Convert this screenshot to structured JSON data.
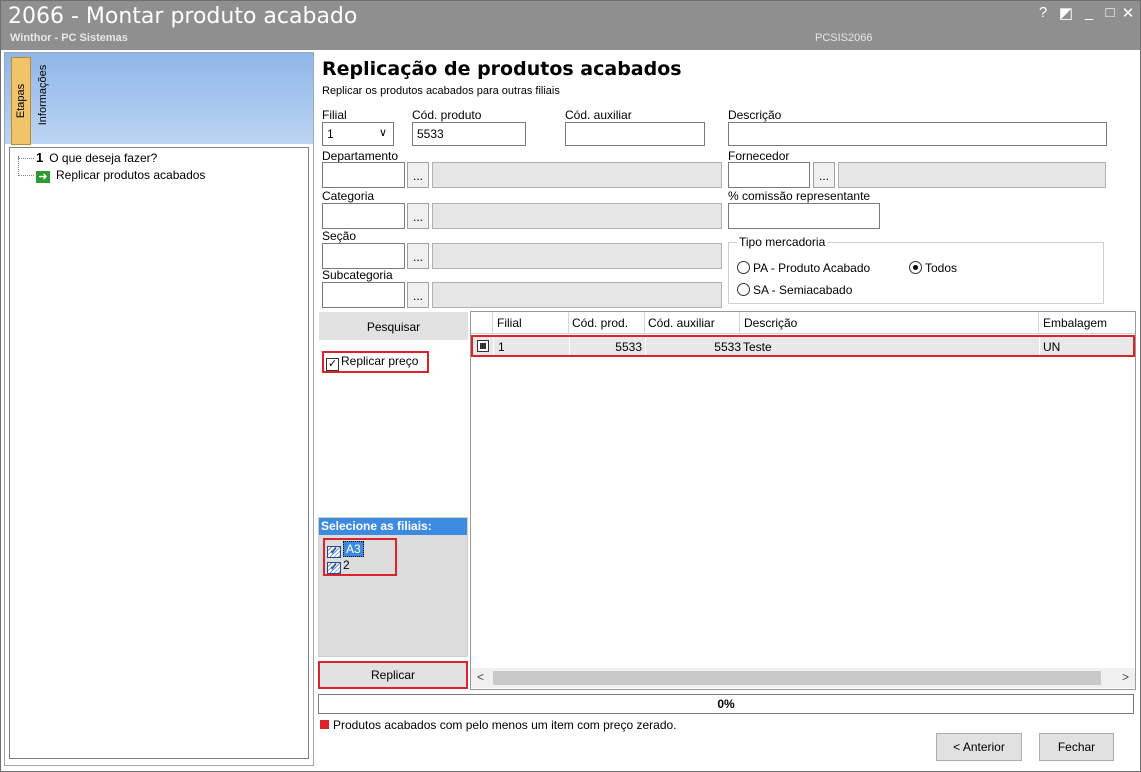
{
  "window": {
    "title": "2066 - Montar produto acabado",
    "subtitle": "Winthor - PC Sistemas",
    "routine_code": "PCSIS2066",
    "help_label": "?",
    "minimize_label": "_",
    "maximize_label": "□",
    "close_label": "✕",
    "restore_label": "◩"
  },
  "left_panel": {
    "tabs": [
      "Etapas",
      "Informações"
    ],
    "steps": [
      {
        "number": "1",
        "label": "O que deseja fazer?"
      },
      {
        "number": "",
        "label": "Replicar produtos acabados"
      }
    ]
  },
  "header": {
    "title": "Replicação de produtos acabados",
    "subtitle": "Replicar os produtos acabados para outras filiais"
  },
  "form": {
    "filial_label": "Filial",
    "filial_value": "1",
    "cod_produto_label": "Cód. produto",
    "cod_produto_value": "5533",
    "cod_auxiliar_label": "Cód. auxiliar",
    "cod_auxiliar_value": "",
    "descricao_label": "Descrição",
    "descricao_value": "",
    "departamento_label": "Departamento",
    "fornecedor_label": "Fornecedor",
    "categoria_label": "Categoria",
    "comissao_label": "% comissão representante",
    "secao_label": "Seção",
    "subcategoria_label": "Subcategoria",
    "lookup_button": "...",
    "tipo_mercadoria": {
      "legend": "Tipo mercadoria",
      "options": [
        "PA - Produto Acabado",
        "Todos",
        "SA - Semiacabado"
      ],
      "selected": "Todos"
    }
  },
  "actions": {
    "pesquisar": "Pesquisar",
    "replicar_preco": "Replicar preço",
    "replicar_preco_checked": true,
    "selecione_filiais": "Selecione as filiais:",
    "filiais": [
      {
        "label": "A3",
        "checked": true,
        "selected": true
      },
      {
        "label": "2",
        "checked": true,
        "selected": false
      }
    ],
    "replicar": "Replicar"
  },
  "grid": {
    "columns": [
      "Filial",
      "Cód. prod.",
      "Cód. auxiliar",
      "Descrição",
      "Embalagem"
    ],
    "rows": [
      {
        "filial": "1",
        "cod_prod": "5533",
        "cod_auxiliar": "5533",
        "descricao": "Teste",
        "embalagem": "UN"
      }
    ],
    "scroll_left": "<",
    "scroll_right": ">"
  },
  "footer": {
    "progress_text": "0%",
    "progress_value": 0,
    "legend_text": "Produtos acabados com pelo menos um item com preço zerado.",
    "legend_color": "#e0222a",
    "anterior": "< Anterior",
    "fechar": "Fechar"
  },
  "colors": {
    "titlebar": "#8f8f8f",
    "highlight": "#d9232d",
    "selection": "#3d8be0"
  }
}
